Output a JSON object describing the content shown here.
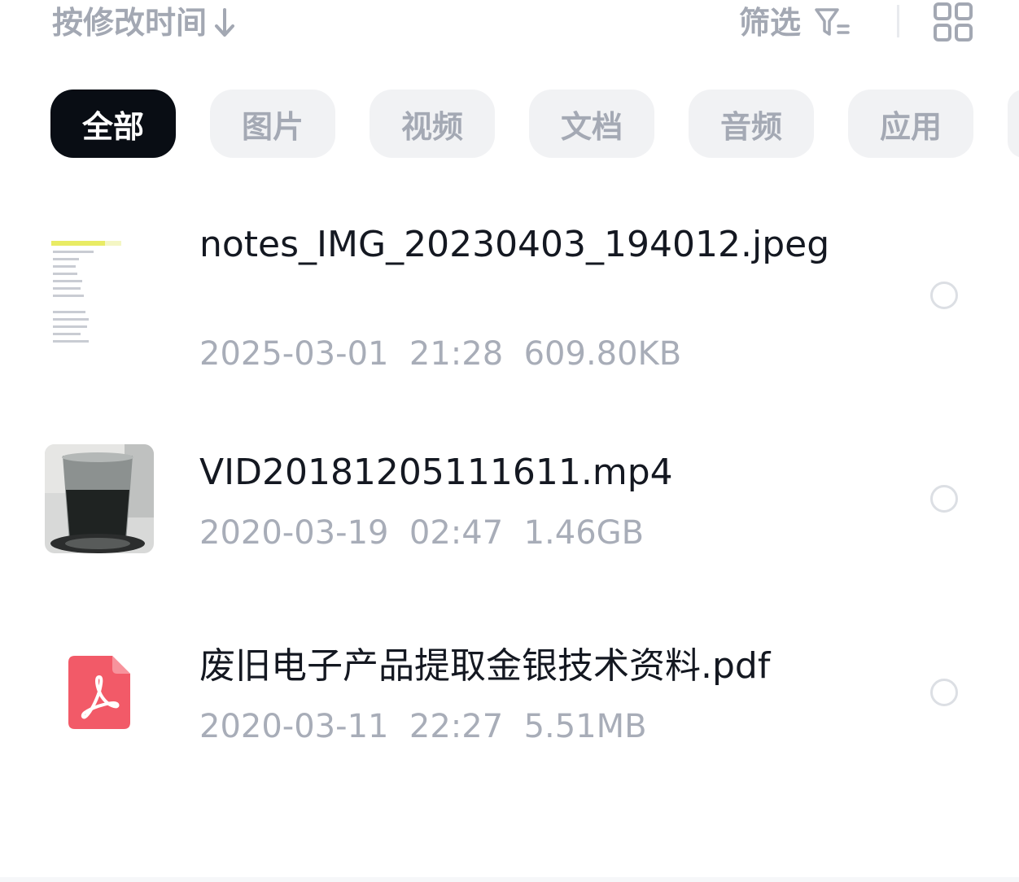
{
  "toolbar": {
    "sort_label": "按修改时间",
    "filter_label": "筛选"
  },
  "chips": [
    {
      "label": "全部",
      "active": true
    },
    {
      "label": "图片",
      "active": false
    },
    {
      "label": "视频",
      "active": false
    },
    {
      "label": "文档",
      "active": false
    },
    {
      "label": "音频",
      "active": false
    },
    {
      "label": "应用",
      "active": false
    }
  ],
  "files": [
    {
      "name": "notes_IMG_20230403_194012.jpeg",
      "meta": "2025-03-01  21:28  609.80KB",
      "thumb": "image-thumbnail"
    },
    {
      "name": "VID20181205111611.mp4",
      "meta": "2020-03-19  02:47  1.46GB",
      "thumb": "video-thumbnail"
    },
    {
      "name": "废旧电子产品提取金银技术资料.pdf",
      "meta": "2020-03-11  22:27  5.51MB",
      "thumb": "pdf-icon"
    }
  ],
  "colors": {
    "accent_active_chip": "#090d14",
    "chip_bg": "#f1f2f4",
    "muted_text": "#a8adb8",
    "pdf_red": "#f25a68"
  }
}
